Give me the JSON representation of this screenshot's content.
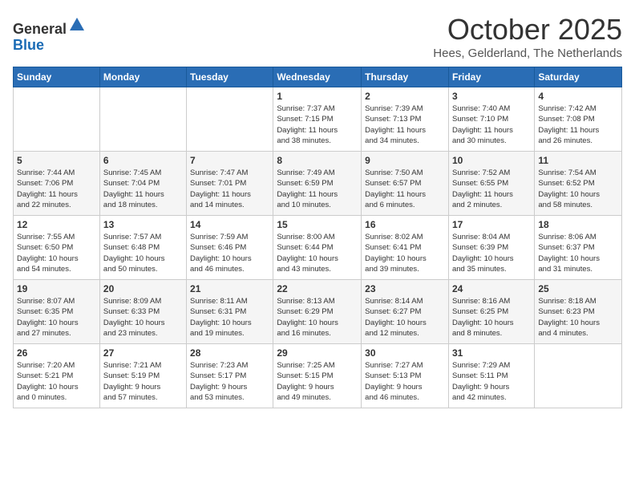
{
  "header": {
    "logo_general": "General",
    "logo_blue": "Blue",
    "month": "October 2025",
    "location": "Hees, Gelderland, The Netherlands"
  },
  "days_of_week": [
    "Sunday",
    "Monday",
    "Tuesday",
    "Wednesday",
    "Thursday",
    "Friday",
    "Saturday"
  ],
  "weeks": [
    [
      {
        "day": "",
        "info": ""
      },
      {
        "day": "",
        "info": ""
      },
      {
        "day": "",
        "info": ""
      },
      {
        "day": "1",
        "info": "Sunrise: 7:37 AM\nSunset: 7:15 PM\nDaylight: 11 hours\nand 38 minutes."
      },
      {
        "day": "2",
        "info": "Sunrise: 7:39 AM\nSunset: 7:13 PM\nDaylight: 11 hours\nand 34 minutes."
      },
      {
        "day": "3",
        "info": "Sunrise: 7:40 AM\nSunset: 7:10 PM\nDaylight: 11 hours\nand 30 minutes."
      },
      {
        "day": "4",
        "info": "Sunrise: 7:42 AM\nSunset: 7:08 PM\nDaylight: 11 hours\nand 26 minutes."
      }
    ],
    [
      {
        "day": "5",
        "info": "Sunrise: 7:44 AM\nSunset: 7:06 PM\nDaylight: 11 hours\nand 22 minutes."
      },
      {
        "day": "6",
        "info": "Sunrise: 7:45 AM\nSunset: 7:04 PM\nDaylight: 11 hours\nand 18 minutes."
      },
      {
        "day": "7",
        "info": "Sunrise: 7:47 AM\nSunset: 7:01 PM\nDaylight: 11 hours\nand 14 minutes."
      },
      {
        "day": "8",
        "info": "Sunrise: 7:49 AM\nSunset: 6:59 PM\nDaylight: 11 hours\nand 10 minutes."
      },
      {
        "day": "9",
        "info": "Sunrise: 7:50 AM\nSunset: 6:57 PM\nDaylight: 11 hours\nand 6 minutes."
      },
      {
        "day": "10",
        "info": "Sunrise: 7:52 AM\nSunset: 6:55 PM\nDaylight: 11 hours\nand 2 minutes."
      },
      {
        "day": "11",
        "info": "Sunrise: 7:54 AM\nSunset: 6:52 PM\nDaylight: 10 hours\nand 58 minutes."
      }
    ],
    [
      {
        "day": "12",
        "info": "Sunrise: 7:55 AM\nSunset: 6:50 PM\nDaylight: 10 hours\nand 54 minutes."
      },
      {
        "day": "13",
        "info": "Sunrise: 7:57 AM\nSunset: 6:48 PM\nDaylight: 10 hours\nand 50 minutes."
      },
      {
        "day": "14",
        "info": "Sunrise: 7:59 AM\nSunset: 6:46 PM\nDaylight: 10 hours\nand 46 minutes."
      },
      {
        "day": "15",
        "info": "Sunrise: 8:00 AM\nSunset: 6:44 PM\nDaylight: 10 hours\nand 43 minutes."
      },
      {
        "day": "16",
        "info": "Sunrise: 8:02 AM\nSunset: 6:41 PM\nDaylight: 10 hours\nand 39 minutes."
      },
      {
        "day": "17",
        "info": "Sunrise: 8:04 AM\nSunset: 6:39 PM\nDaylight: 10 hours\nand 35 minutes."
      },
      {
        "day": "18",
        "info": "Sunrise: 8:06 AM\nSunset: 6:37 PM\nDaylight: 10 hours\nand 31 minutes."
      }
    ],
    [
      {
        "day": "19",
        "info": "Sunrise: 8:07 AM\nSunset: 6:35 PM\nDaylight: 10 hours\nand 27 minutes."
      },
      {
        "day": "20",
        "info": "Sunrise: 8:09 AM\nSunset: 6:33 PM\nDaylight: 10 hours\nand 23 minutes."
      },
      {
        "day": "21",
        "info": "Sunrise: 8:11 AM\nSunset: 6:31 PM\nDaylight: 10 hours\nand 19 minutes."
      },
      {
        "day": "22",
        "info": "Sunrise: 8:13 AM\nSunset: 6:29 PM\nDaylight: 10 hours\nand 16 minutes."
      },
      {
        "day": "23",
        "info": "Sunrise: 8:14 AM\nSunset: 6:27 PM\nDaylight: 10 hours\nand 12 minutes."
      },
      {
        "day": "24",
        "info": "Sunrise: 8:16 AM\nSunset: 6:25 PM\nDaylight: 10 hours\nand 8 minutes."
      },
      {
        "day": "25",
        "info": "Sunrise: 8:18 AM\nSunset: 6:23 PM\nDaylight: 10 hours\nand 4 minutes."
      }
    ],
    [
      {
        "day": "26",
        "info": "Sunrise: 7:20 AM\nSunset: 5:21 PM\nDaylight: 10 hours\nand 0 minutes."
      },
      {
        "day": "27",
        "info": "Sunrise: 7:21 AM\nSunset: 5:19 PM\nDaylight: 9 hours\nand 57 minutes."
      },
      {
        "day": "28",
        "info": "Sunrise: 7:23 AM\nSunset: 5:17 PM\nDaylight: 9 hours\nand 53 minutes."
      },
      {
        "day": "29",
        "info": "Sunrise: 7:25 AM\nSunset: 5:15 PM\nDaylight: 9 hours\nand 49 minutes."
      },
      {
        "day": "30",
        "info": "Sunrise: 7:27 AM\nSunset: 5:13 PM\nDaylight: 9 hours\nand 46 minutes."
      },
      {
        "day": "31",
        "info": "Sunrise: 7:29 AM\nSunset: 5:11 PM\nDaylight: 9 hours\nand 42 minutes."
      },
      {
        "day": "",
        "info": ""
      }
    ]
  ]
}
